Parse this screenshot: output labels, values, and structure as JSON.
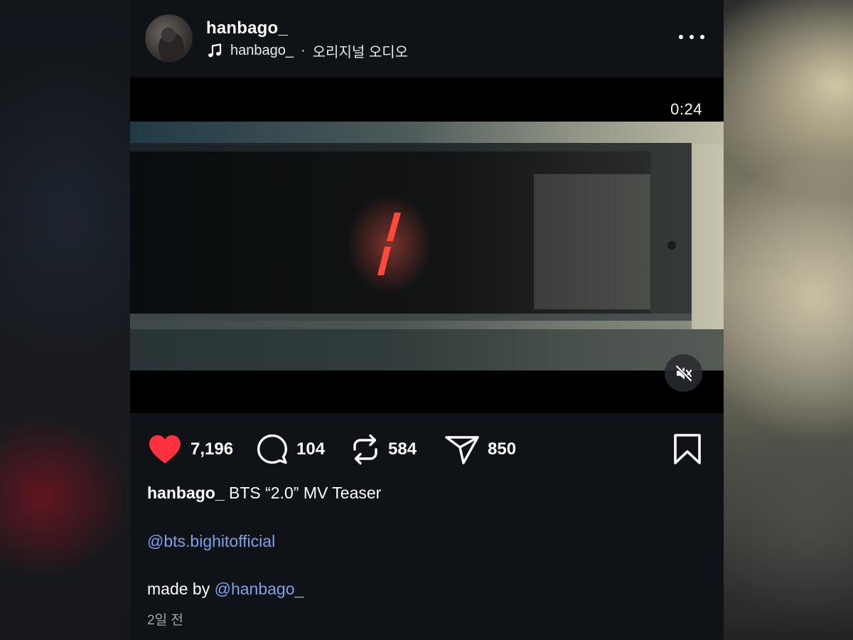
{
  "post": {
    "username": "hanbago_",
    "audio": {
      "icon": "music-note-icon",
      "artist": "hanbago_",
      "separator": "·",
      "title": "오리지널 오디오"
    },
    "video": {
      "duration": "0:24",
      "muted": true
    },
    "actions": {
      "likes": "7,196",
      "comments": "104",
      "reposts": "584",
      "shares": "850",
      "liked": true,
      "like_color": "#ff3040"
    },
    "caption": {
      "username": "hanbago_",
      "text": " BTS “2.0” MV Teaser",
      "mention_line": "@bts.bighitofficial",
      "made_by_prefix": "made by ",
      "made_by_mention": "@hanbago_"
    },
    "timestamp": "2일 전"
  },
  "colors": {
    "background": "#0f1318",
    "mention": "#7ea1e8",
    "secondary_text": "#a4a8ad"
  }
}
